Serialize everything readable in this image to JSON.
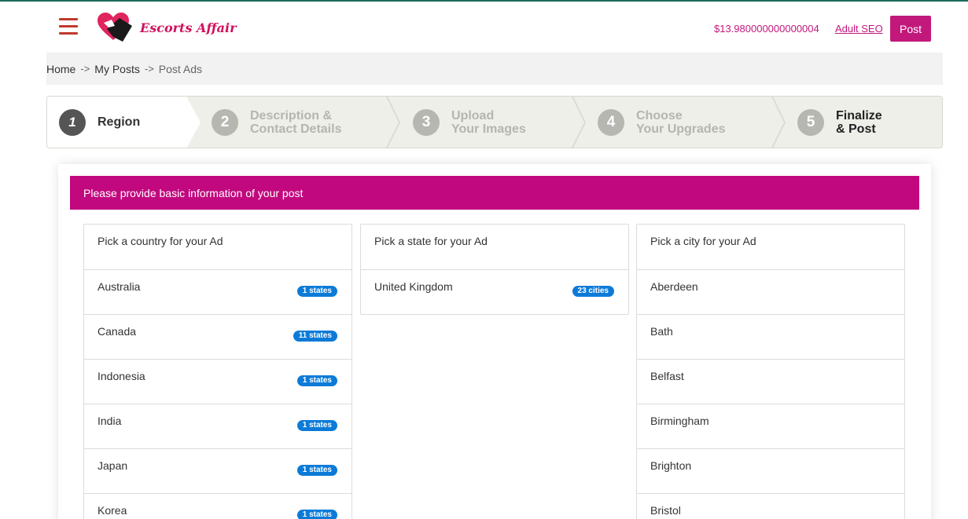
{
  "header": {
    "logo_text": "Escorts Affair",
    "balance": "$13.980000000000004",
    "seo_link": "Adult SEO",
    "post_button": "Post"
  },
  "breadcrumb": {
    "home": "Home",
    "my_posts": "My Posts",
    "current": "Post Ads",
    "separator": "->"
  },
  "steps": [
    {
      "number": "1",
      "line1": "Region",
      "line2": ""
    },
    {
      "number": "2",
      "line1": "Description &",
      "line2": "Contact Details"
    },
    {
      "number": "3",
      "line1": "Upload",
      "line2": "Your Images"
    },
    {
      "number": "4",
      "line1": "Choose",
      "line2": "Your Upgrades"
    },
    {
      "number": "5",
      "line1": "Finalize",
      "line2": "& Post"
    }
  ],
  "banner": "Please provide basic information of your post",
  "countries": {
    "heading": "Pick a country for your Ad",
    "items": [
      {
        "name": "Australia",
        "badge": "1 states"
      },
      {
        "name": "Canada",
        "badge": "11 states"
      },
      {
        "name": "Indonesia",
        "badge": "1 states"
      },
      {
        "name": "India",
        "badge": "1 states"
      },
      {
        "name": "Japan",
        "badge": "1 states"
      },
      {
        "name": "Korea",
        "badge": "1 states"
      }
    ]
  },
  "states": {
    "heading": "Pick a state for your Ad",
    "items": [
      {
        "name": "United Kingdom",
        "badge": "23 cities"
      }
    ]
  },
  "cities": {
    "heading": "Pick a city for your Ad",
    "items": [
      {
        "name": "Aberdeen"
      },
      {
        "name": "Bath"
      },
      {
        "name": "Belfast"
      },
      {
        "name": "Birmingham"
      },
      {
        "name": "Brighton"
      },
      {
        "name": "Bristol"
      }
    ]
  },
  "colors": {
    "brand": "#c2087e",
    "badge": "#0c7bd8",
    "hamburger": "#c0392b"
  }
}
